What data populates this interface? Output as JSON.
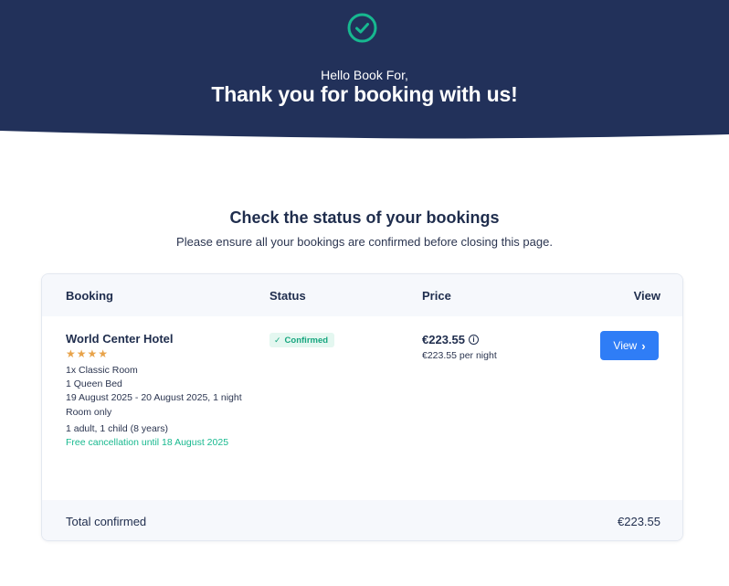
{
  "header": {
    "greeting": "Hello Book For,",
    "title": "Thank you for booking with us!",
    "icon": "check-circle-icon",
    "background_color": "#22315a",
    "accent_color": "#17b890"
  },
  "section": {
    "title": "Check the status of your bookings",
    "subtitle": "Please ensure all your bookings are confirmed before closing this page."
  },
  "table": {
    "columns": {
      "booking": "Booking",
      "status": "Status",
      "price": "Price",
      "view": "View"
    },
    "rows": [
      {
        "hotel_name": "World Center Hotel",
        "stars": "★★★★",
        "star_rating": 4,
        "room": "1x Classic Room",
        "bed": "1 Queen Bed",
        "dates": "19 August 2025 - 20 August 2025, 1 night",
        "board": "Room only",
        "guests": "1 adult, 1 child (8 years)",
        "cancellation": "Free cancellation until 18 August 2025",
        "status": "Confirmed",
        "price": "€223.55",
        "price_per_night": "€223.55 per night",
        "view_label": "View"
      }
    ],
    "footer": {
      "label": "Total confirmed",
      "total": "€223.55"
    }
  }
}
